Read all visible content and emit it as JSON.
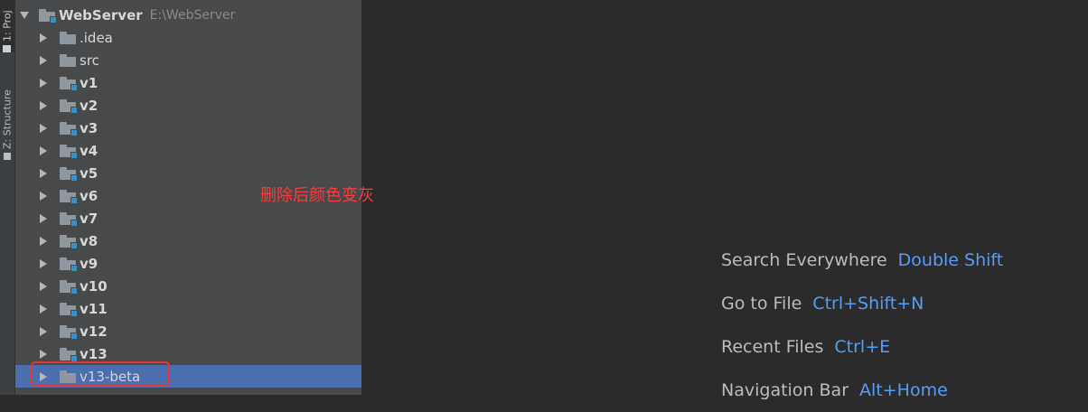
{
  "tool_strip": {
    "project_tab": "1: Proj",
    "structure_tab": "Z: Structure"
  },
  "tree": {
    "root": {
      "label": "WebServer",
      "path": "E:\\WebServer"
    },
    "items": [
      {
        "label": ".idea",
        "module": false,
        "bold": false
      },
      {
        "label": "src",
        "module": false,
        "bold": false
      },
      {
        "label": "v1",
        "module": true,
        "bold": true
      },
      {
        "label": "v2",
        "module": true,
        "bold": true
      },
      {
        "label": "v3",
        "module": true,
        "bold": true
      },
      {
        "label": "v4",
        "module": true,
        "bold": true
      },
      {
        "label": "v5",
        "module": true,
        "bold": true
      },
      {
        "label": "v6",
        "module": true,
        "bold": true
      },
      {
        "label": "v7",
        "module": true,
        "bold": true
      },
      {
        "label": "v8",
        "module": true,
        "bold": true
      },
      {
        "label": "v9",
        "module": true,
        "bold": true
      },
      {
        "label": "v10",
        "module": true,
        "bold": true
      },
      {
        "label": "v11",
        "module": true,
        "bold": true
      },
      {
        "label": "v12",
        "module": true,
        "bold": true
      },
      {
        "label": "v13",
        "module": true,
        "bold": true
      },
      {
        "label": "v13-beta",
        "module": false,
        "bold": false,
        "selected": true
      }
    ]
  },
  "annotation": {
    "text": "删除后颜色变灰",
    "color": "#ff3b3b"
  },
  "editor_hints": [
    {
      "label": "Search Everywhere",
      "key": "Double Shift"
    },
    {
      "label": "Go to File",
      "key": "Ctrl+Shift+N"
    },
    {
      "label": "Recent Files",
      "key": "Ctrl+E"
    },
    {
      "label": "Navigation Bar",
      "key": "Alt+Home"
    }
  ],
  "colors": {
    "selection": "#4b6eaf",
    "shortcut": "#589df6",
    "module_marker": "#3592c4"
  }
}
